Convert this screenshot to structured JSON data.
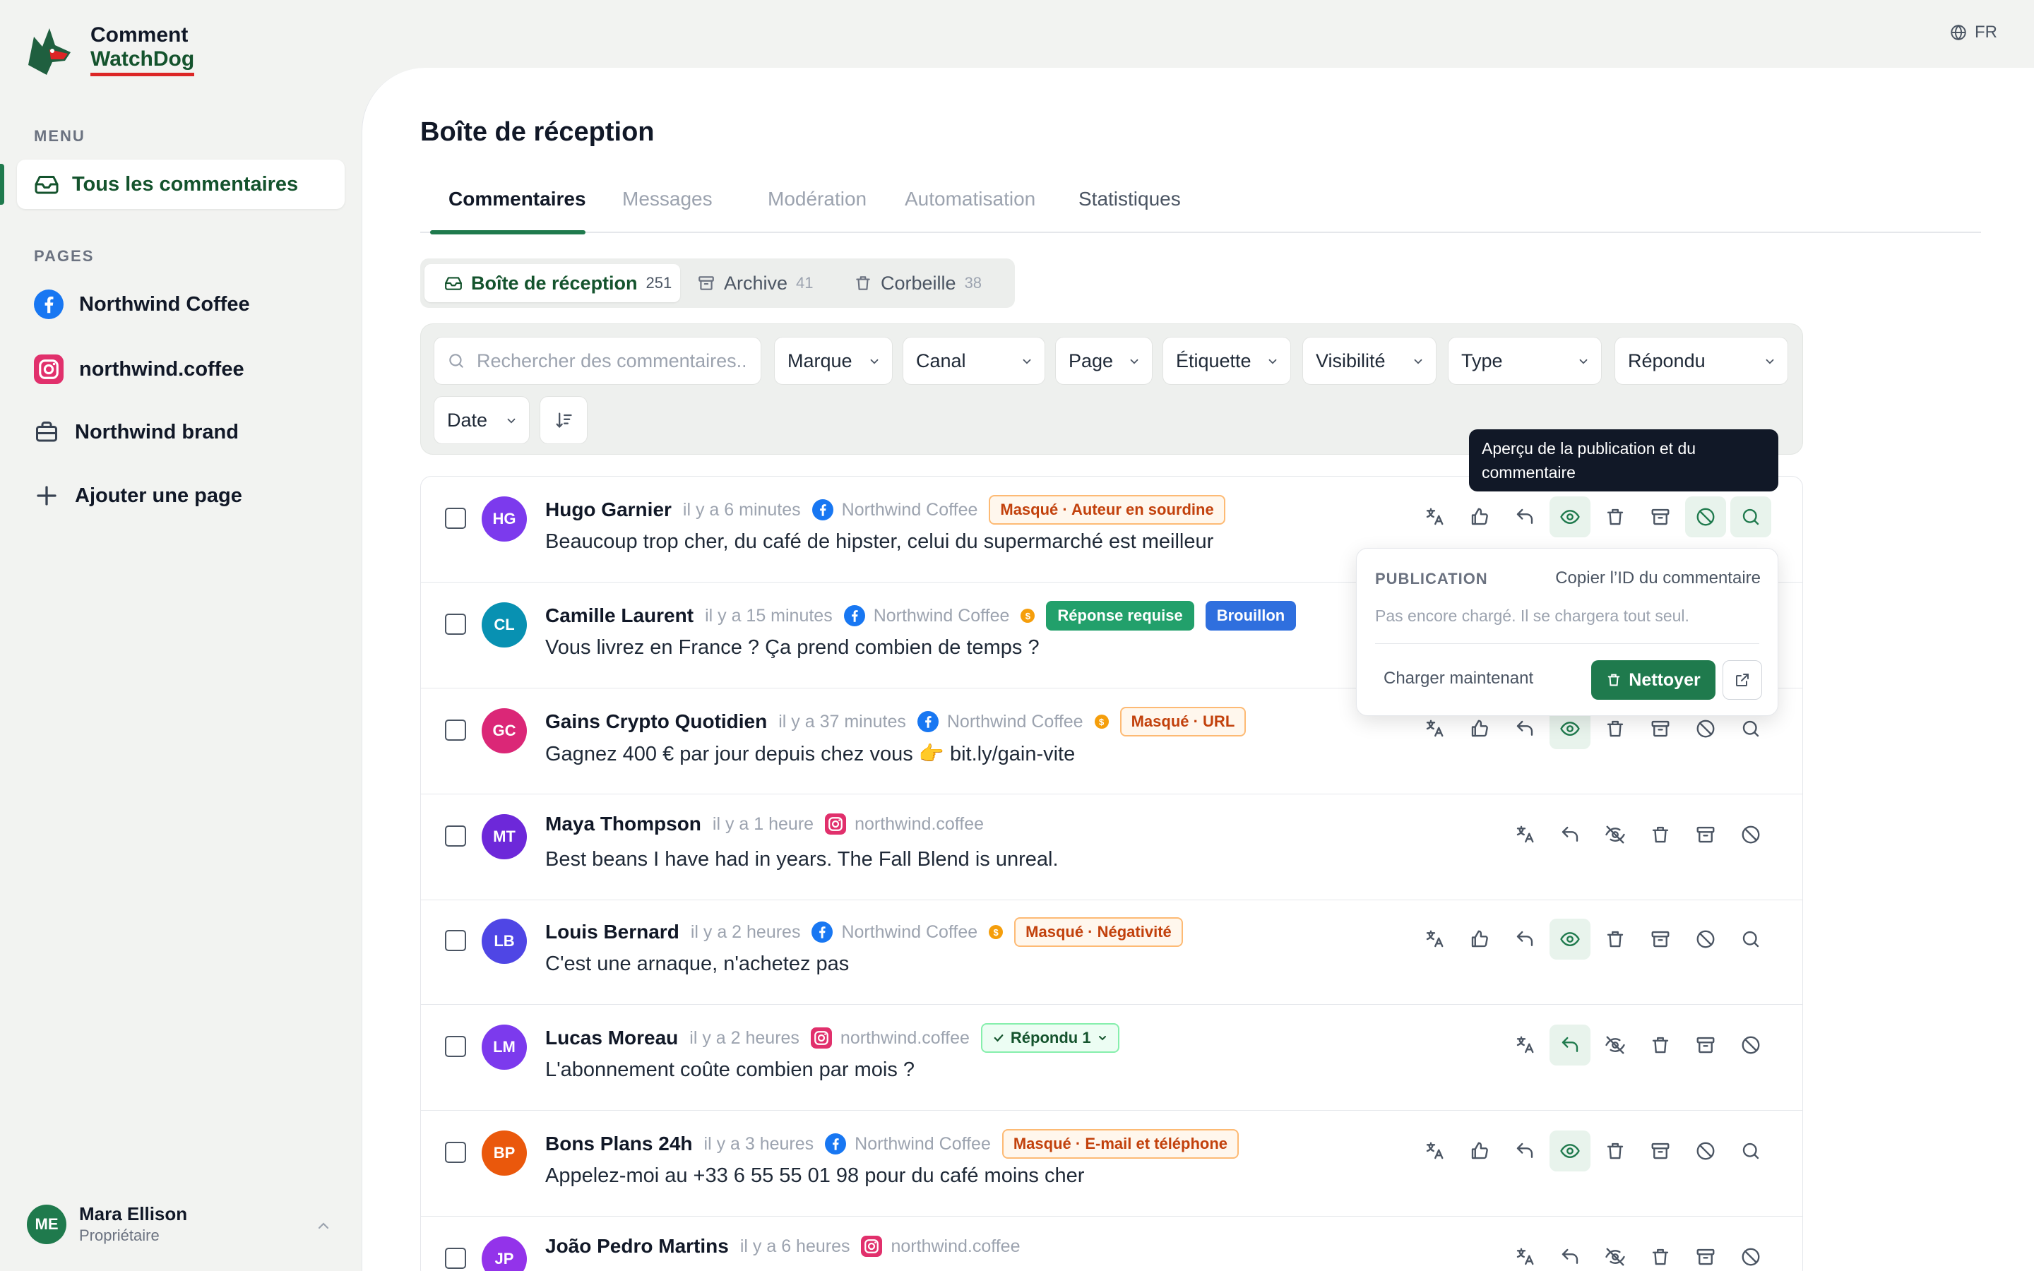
{
  "app": {
    "logo_line1": "Comment",
    "logo_line2": "WatchDog",
    "language": "FR"
  },
  "sidebar": {
    "menu_label": "MENU",
    "menu_item": "Tous les commentaires",
    "pages_label": "PAGES",
    "pages": [
      {
        "label": "Northwind Coffee",
        "icon": "facebook-icon"
      },
      {
        "label": "northwind.coffee",
        "icon": "instagram-icon"
      },
      {
        "label": "Northwind brand",
        "icon": "briefcase-icon"
      },
      {
        "label": "Ajouter une page",
        "icon": "plus-icon"
      }
    ],
    "user": {
      "initials": "ME",
      "name": "Mara Ellison",
      "role": "Propriétaire"
    }
  },
  "main": {
    "title": "Boîte de réception",
    "tabs": [
      "Commentaires",
      "Messages",
      "Modération",
      "Automatisation",
      "Statistiques"
    ],
    "segments": [
      {
        "label": "Boîte de réception",
        "count": "251"
      },
      {
        "label": "Archive",
        "count": "41"
      },
      {
        "label": "Corbeille",
        "count": "38"
      }
    ],
    "filters": {
      "search_placeholder": "Rechercher des commentaires...",
      "marque": "Marque",
      "canal": "Canal",
      "page": "Page",
      "etiquette": "Étiquette",
      "visibilite": "Visibilité",
      "type": "Type",
      "repondu": "Répondu",
      "date": "Date"
    },
    "comments": [
      {
        "initials": "HG",
        "author": "Hugo Garnier",
        "time": "il y a 6 minutes",
        "source": "Northwind Coffee",
        "platform": "facebook",
        "warn": false,
        "badges": [
          {
            "text": "Masqué · Auteur en sourdine",
            "kind": "orange"
          }
        ],
        "text": "Beaucoup trop cher, du café de hipster, celui du supermarché est meilleur",
        "color": "#7c3aed"
      },
      {
        "initials": "CL",
        "author": "Camille Laurent",
        "time": "il y a 15 minutes",
        "source": "Northwind Coffee",
        "platform": "facebook",
        "warn": true,
        "badges": [
          {
            "text": "Réponse requise",
            "kind": "green"
          },
          {
            "text": "Brouillon",
            "kind": "blue"
          }
        ],
        "text": "Vous livrez en France ? Ça prend combien de temps ?",
        "color": "#0891b2"
      },
      {
        "initials": "GC",
        "author": "Gains Crypto Quotidien",
        "time": "il y a 37 minutes",
        "source": "Northwind Coffee",
        "platform": "facebook",
        "warn": true,
        "badges": [
          {
            "text": "Masqué · URL",
            "kind": "orange"
          }
        ],
        "text": "Gagnez 400 € par jour depuis chez vous 👉 bit.ly/gain-vite",
        "color": "#db2777"
      },
      {
        "initials": "MT",
        "author": "Maya Thompson",
        "time": "il y a 1 heure",
        "source": "northwind.coffee",
        "platform": "instagram",
        "warn": false,
        "badges": [],
        "text": "Best beans I have had in years. The Fall Blend is unreal.",
        "color": "#6d28d9"
      },
      {
        "initials": "LB",
        "author": "Louis Bernard",
        "time": "il y a 2 heures",
        "source": "Northwind Coffee",
        "platform": "facebook",
        "warn": true,
        "badges": [
          {
            "text": "Masqué · Négativité",
            "kind": "orange"
          }
        ],
        "text": "C'est une arnaque, n'achetez pas",
        "color": "#4f46e5"
      },
      {
        "initials": "LM",
        "author": "Lucas Moreau",
        "time": "il y a 2 heures",
        "source": "northwind.coffee",
        "platform": "instagram",
        "warn": false,
        "badges": [
          {
            "text": "Répondu 1",
            "kind": "replied"
          }
        ],
        "text": "L'abonnement coûte combien par mois ?",
        "color": "#7c3aed"
      },
      {
        "initials": "BP",
        "author": "Bons Plans 24h",
        "time": "il y a 3 heures",
        "source": "Northwind Coffee",
        "platform": "facebook",
        "warn": false,
        "badges": [
          {
            "text": "Masqué · E-mail et téléphone",
            "kind": "orange"
          }
        ],
        "text": "Appelez-moi au +33 6 55 55 01 98 pour du café moins cher",
        "color": "#ea580c"
      },
      {
        "initials": "JP",
        "author": "João Pedro Martins",
        "time": "il y a 6 heures",
        "source": "northwind.coffee",
        "platform": "instagram",
        "warn": false,
        "badges": [],
        "text": "",
        "color": "#9333ea"
      }
    ],
    "tooltip": "Aperçu de la publication et du commentaire",
    "popover": {
      "label": "PUBLICATION",
      "copy_id": "Copier l’ID du commentaire",
      "empty": "Pas encore chargé. Il se chargera tout seul.",
      "load_now": "Charger maintenant",
      "clean": "Nettoyer"
    }
  }
}
